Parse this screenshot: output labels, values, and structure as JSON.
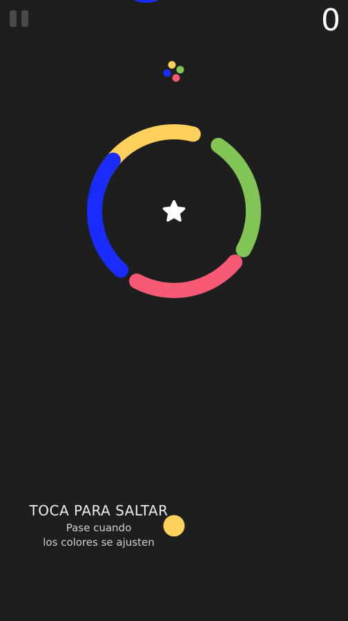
{
  "hud": {
    "pause_icon": "pause-icon",
    "score": "0"
  },
  "colors": {
    "background": "#1e1e1e",
    "yellow": "#fdd15c",
    "green": "#81c556",
    "pink": "#f75a72",
    "blue": "#1a2cfd",
    "white": "#ffffff"
  },
  "game": {
    "ring_segments": [
      "yellow",
      "green",
      "pink",
      "blue"
    ],
    "star_icon": "star-icon",
    "color_switcher_icon": "color-switcher-icon",
    "player_ball_color": "yellow"
  },
  "tutorial": {
    "title": "TOCA PARA SALTAR",
    "line1": "Pase cuando",
    "line2": "los colores se ajusten"
  }
}
